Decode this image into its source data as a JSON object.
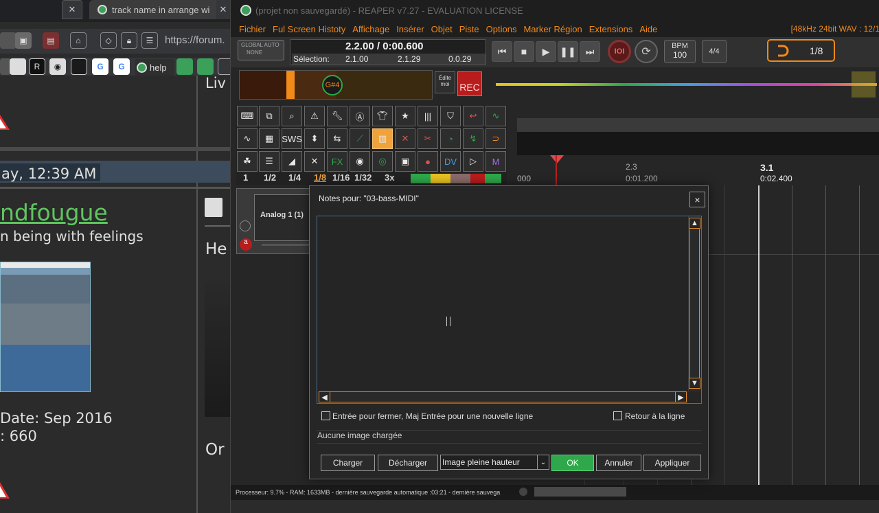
{
  "browser": {
    "tab_active_label": "track name in arrange wi",
    "tab_close": "✕",
    "url_text": "https://forum.",
    "bookmark_help": "help",
    "forum": {
      "side_text": "Liv",
      "timestamp": "ay, 12:39 AM",
      "username": "ndfougue",
      "user_subtitle": "n being with feelings",
      "join_date": "Date: Sep 2016",
      "posts": ": 660",
      "post_snippet_1": "He",
      "post_snippet_2": "Or"
    }
  },
  "reaper": {
    "window_title": "(projet non sauvegardé) - REAPER v7.27 - EVALUATION LICENSE",
    "menu": [
      "Fichier",
      "Ful Screen Histoty",
      "Affichage",
      "Insérer",
      "Objet",
      "Piste",
      "Options",
      "Marker Région",
      "Extensions",
      "Aide"
    ],
    "format_status": "[48kHz 24bit WAV : 12/1",
    "global_auto_label": "GLOBAL AUTO",
    "global_auto_value": "NONE",
    "position": "2.2.00 / 0:00.600",
    "selection_label": "Sélection:",
    "selection_start": "2.1.00",
    "selection_end": "2.1.29",
    "selection_length": "0.0.29",
    "bpm_label": "BPM",
    "bpm_value": "100",
    "time_signature": "4/4",
    "grid_value": "1/8",
    "note_display": "G#4",
    "edit_me_label": "Édite\nmoi",
    "rec_label": "REC",
    "divisions": [
      "1",
      "1/2",
      "1/4",
      "1/8",
      "1/16",
      "1/32",
      "3x"
    ],
    "ruler": {
      "mark_a_time": "000",
      "mark_b_bar": "2.3",
      "mark_b_time": "0:01.200",
      "mark_c_bar": "3.1",
      "mark_c_time": "0:02.400"
    },
    "track_name": "Analog 1 (1)",
    "status_bar": "Processeur: 9.7% - RAM: 1633MB - dernière sauvegarde automatique :03:21 - dernière sauvega"
  },
  "dialog": {
    "title": "Notes pour: \"03-bass-MIDI\"",
    "close": "×",
    "scroll_up": "▲",
    "scroll_down": "▼",
    "scroll_left": "◀",
    "scroll_right": "▶",
    "enter_to_close_label": "Entrée pour fermer, Maj Entrée pour une nouvelle ligne",
    "word_wrap_label": "Retour à la ligne",
    "image_status": "Aucune image chargée",
    "load_button": "Charger",
    "unload_button": "Décharger",
    "image_mode_value": "Image pleine hauteur",
    "ok_button": "OK",
    "cancel_button": "Annuler",
    "apply_button": "Appliquer"
  },
  "colors": {
    "reaper_accent": "#f28a1a",
    "ok_green": "#2ea84a",
    "rec_red": "#b81c1c"
  }
}
